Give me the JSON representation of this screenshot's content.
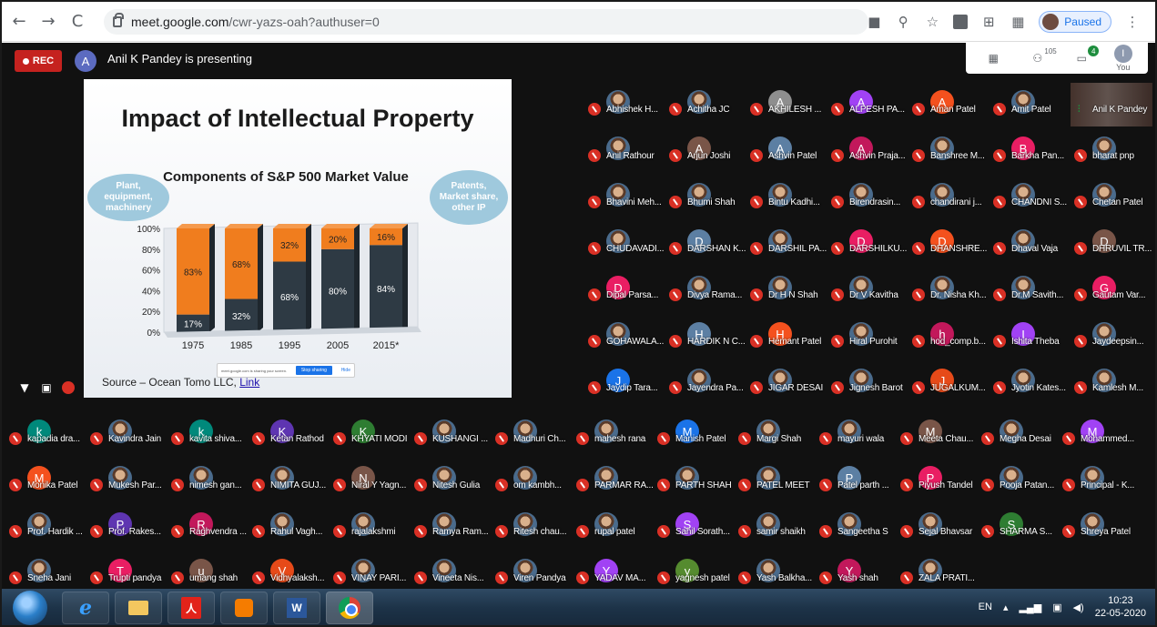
{
  "browser": {
    "back": "←",
    "forward": "→",
    "reload": "C",
    "url_host": "meet.google.com",
    "url_path": "/cwr-yazs-oah?authuser=0",
    "profile_status": "Paused"
  },
  "meet": {
    "rec_label": "REC",
    "presenter_initial": "A",
    "presenter_text": "Anil K Pandey is presenting",
    "people_count": "105",
    "chat_count": "4",
    "you_initial": "I",
    "you_label": "You"
  },
  "slide": {
    "title": "Impact of Intellectual Property",
    "chart_title": "Components of S&P 500 Market Value",
    "callout_left": "Plant, equipment, machinery",
    "callout_right": "Patents, Market share, other IP",
    "source": "Source – Ocean Tomo LLC,",
    "source_link": "Link",
    "share_text": "meet.google.com is sharing your screen.",
    "stop_sharing": "Stop sharing",
    "hide": "Hide"
  },
  "chart_data": {
    "type": "bar",
    "title": "Components of S&P 500 Market Value",
    "categories": [
      "1975",
      "1985",
      "1995",
      "2005",
      "2015*"
    ],
    "series": [
      {
        "values": [
          17,
          32,
          68,
          80,
          84
        ],
        "color": "#2e3a44"
      },
      {
        "values": [
          83,
          68,
          32,
          20,
          16
        ],
        "color": "#f07d1e"
      }
    ],
    "value_labels": {
      "bottom": [
        "17%",
        "32%",
        "68%",
        "80%",
        "84%"
      ],
      "top": [
        "83%",
        "68%",
        "32%",
        "20%",
        "16%"
      ]
    },
    "y_ticks": [
      "100%",
      "80%",
      "60%",
      "40%",
      "20%",
      "0%"
    ],
    "ylim": [
      0,
      100
    ]
  },
  "participants": [
    {
      "name": "Abhishek H...",
      "initial": "",
      "photo": true,
      "color": "#5f6368"
    },
    {
      "name": "Achitha JC",
      "initial": "",
      "photo": true,
      "color": "#5f6368"
    },
    {
      "name": "AKHILESH ...",
      "initial": "A",
      "photo": false,
      "color": "#8e8e8e"
    },
    {
      "name": "ALPESH PA...",
      "initial": "A",
      "photo": false,
      "color": "#a142f4"
    },
    {
      "name": "Aman Patel",
      "initial": "A",
      "photo": false,
      "color": "#f4511e"
    },
    {
      "name": "Amit Patel",
      "initial": "",
      "photo": true,
      "color": "#5f6368"
    },
    {
      "name": "Anil K Pandey",
      "initial": "",
      "photo": true,
      "color": "#5f6368",
      "speaking": true
    },
    {
      "name": "Anil Rathour",
      "initial": "",
      "photo": true,
      "color": "#5f6368"
    },
    {
      "name": "Arjun Joshi",
      "initial": "A",
      "photo": false,
      "color": "#795548"
    },
    {
      "name": "Ashvin Patel",
      "initial": "A",
      "photo": false,
      "color": "#5c7fa3"
    },
    {
      "name": "Ashvin Praja...",
      "initial": "A",
      "photo": false,
      "color": "#c2185b"
    },
    {
      "name": "Banshree M...",
      "initial": "",
      "photo": true,
      "color": "#5f6368"
    },
    {
      "name": "Barkha Pan...",
      "initial": "B",
      "photo": false,
      "color": "#e91e63"
    },
    {
      "name": "bharat pnp",
      "initial": "",
      "photo": true,
      "color": "#5f6368"
    },
    {
      "name": "Bhavini Meh...",
      "initial": "",
      "photo": true,
      "color": "#5f6368"
    },
    {
      "name": "Bhumi Shah",
      "initial": "",
      "photo": true,
      "color": "#5f6368"
    },
    {
      "name": "Bintu Kadhi...",
      "initial": "",
      "photo": true,
      "color": "#5f6368"
    },
    {
      "name": "Birendrasin...",
      "initial": "",
      "photo": true,
      "color": "#5f6368"
    },
    {
      "name": "chandirani j...",
      "initial": "",
      "photo": true,
      "color": "#5f6368"
    },
    {
      "name": "CHANDNI S...",
      "initial": "",
      "photo": true,
      "color": "#5f6368"
    },
    {
      "name": "Chetan Patel",
      "initial": "",
      "photo": true,
      "color": "#5f6368"
    },
    {
      "name": "CHUDAVADI...",
      "initial": "",
      "photo": true,
      "color": "#5f6368"
    },
    {
      "name": "DARSHAN K...",
      "initial": "D",
      "photo": false,
      "color": "#5c7fa3"
    },
    {
      "name": "DARSHIL PA...",
      "initial": "",
      "photo": true,
      "color": "#5f6368"
    },
    {
      "name": "DARSHILKU...",
      "initial": "D",
      "photo": false,
      "color": "#e91e63"
    },
    {
      "name": "DHANSHRE...",
      "initial": "D",
      "photo": false,
      "color": "#f4511e"
    },
    {
      "name": "Dhaval Vaja",
      "initial": "",
      "photo": true,
      "color": "#5f6368"
    },
    {
      "name": "DHRUVIL TR...",
      "initial": "D",
      "photo": false,
      "color": "#795548"
    },
    {
      "name": "Dipal Parsa...",
      "initial": "D",
      "photo": false,
      "color": "#e91e63"
    },
    {
      "name": "Divya Rama...",
      "initial": "",
      "photo": true,
      "color": "#5f6368"
    },
    {
      "name": "Dr H N Shah",
      "initial": "",
      "photo": true,
      "color": "#5f6368"
    },
    {
      "name": "Dr V Kavitha",
      "initial": "",
      "photo": true,
      "color": "#5f6368"
    },
    {
      "name": "Dr. Nisha Kh...",
      "initial": "",
      "photo": true,
      "color": "#5f6368"
    },
    {
      "name": "Dr.M Savith...",
      "initial": "",
      "photo": true,
      "color": "#5f6368"
    },
    {
      "name": "Gautam Var...",
      "initial": "G",
      "photo": false,
      "color": "#e91e63"
    },
    {
      "name": "GOHAWALA...",
      "initial": "",
      "photo": true,
      "color": "#5f6368"
    },
    {
      "name": "HARDIK N C...",
      "initial": "H",
      "photo": false,
      "color": "#5c7fa3"
    },
    {
      "name": "Hemant Patel",
      "initial": "H",
      "photo": false,
      "color": "#f4511e"
    },
    {
      "name": "Hiral Purohit",
      "initial": "",
      "photo": true,
      "color": "#5f6368"
    },
    {
      "name": "hod_comp.b...",
      "initial": "h",
      "photo": false,
      "color": "#c2185b"
    },
    {
      "name": "Ishita Theba",
      "initial": "I",
      "photo": false,
      "color": "#a142f4"
    },
    {
      "name": "Jaydeepsin...",
      "initial": "",
      "photo": true,
      "color": "#5f6368"
    },
    {
      "name": "Jaydip Tara...",
      "initial": "J",
      "photo": false,
      "color": "#1a73e8"
    },
    {
      "name": "Jayendra Pa...",
      "initial": "",
      "photo": true,
      "color": "#5f6368"
    },
    {
      "name": "JIGAR DESAI",
      "initial": "",
      "photo": true,
      "color": "#5f6368"
    },
    {
      "name": "Jignesh Barot",
      "initial": "",
      "photo": true,
      "color": "#5f6368"
    },
    {
      "name": "JUGALKUM...",
      "initial": "J",
      "photo": false,
      "color": "#e64a19"
    },
    {
      "name": "Jyotin Kates...",
      "initial": "",
      "photo": true,
      "color": "#5f6368"
    },
    {
      "name": "Kamlesh M...",
      "initial": "",
      "photo": true,
      "color": "#5f6368"
    },
    {
      "name": "kapadia dra...",
      "initial": "k",
      "photo": false,
      "color": "#00897b"
    },
    {
      "name": "Kavindra Jain",
      "initial": "",
      "photo": true,
      "color": "#5f6368"
    },
    {
      "name": "kavita shiva...",
      "initial": "k",
      "photo": false,
      "color": "#00897b"
    },
    {
      "name": "Ketan Rathod",
      "initial": "K",
      "photo": false,
      "color": "#5e35b1"
    },
    {
      "name": "KHYATI MODI",
      "initial": "K",
      "photo": false,
      "color": "#2e7d32"
    },
    {
      "name": "KUSHANGI ...",
      "initial": "",
      "photo": true,
      "color": "#5f6368"
    },
    {
      "name": "Madhuri Ch...",
      "initial": "",
      "photo": true,
      "color": "#5f6368"
    },
    {
      "name": "mahesh rana",
      "initial": "",
      "photo": true,
      "color": "#5f6368"
    },
    {
      "name": "Manish Patel",
      "initial": "M",
      "photo": false,
      "color": "#1a73e8"
    },
    {
      "name": "Margi Shah",
      "initial": "",
      "photo": true,
      "color": "#5f6368"
    },
    {
      "name": "mayuri wala",
      "initial": "",
      "photo": true,
      "color": "#5f6368"
    },
    {
      "name": "Meeta Chau...",
      "initial": "M",
      "photo": false,
      "color": "#795548"
    },
    {
      "name": "Megha Desai",
      "initial": "",
      "photo": true,
      "color": "#5f6368"
    },
    {
      "name": "Mohammed...",
      "initial": "M",
      "photo": false,
      "color": "#a142f4"
    },
    {
      "name": "Monika Patel",
      "initial": "M",
      "photo": false,
      "color": "#f4511e"
    },
    {
      "name": "Mukesh Par...",
      "initial": "",
      "photo": true,
      "color": "#5f6368"
    },
    {
      "name": "nimesh gan...",
      "initial": "",
      "photo": true,
      "color": "#5f6368"
    },
    {
      "name": "NIMITA GUJ...",
      "initial": "",
      "photo": true,
      "color": "#5f6368"
    },
    {
      "name": "Niral Y Yagn...",
      "initial": "N",
      "photo": false,
      "color": "#795548"
    },
    {
      "name": "Nitesh Gulia",
      "initial": "",
      "photo": true,
      "color": "#5f6368"
    },
    {
      "name": "om kambh...",
      "initial": "",
      "photo": true,
      "color": "#5f6368"
    },
    {
      "name": "PARMAR RA...",
      "initial": "",
      "photo": true,
      "color": "#5f6368"
    },
    {
      "name": "PARTH SHAH",
      "initial": "",
      "photo": true,
      "color": "#5f6368"
    },
    {
      "name": "PATEL MEET",
      "initial": "",
      "photo": true,
      "color": "#5f6368"
    },
    {
      "name": "Patel parth ...",
      "initial": "P",
      "photo": false,
      "color": "#5c7fa3"
    },
    {
      "name": "Piyush Tandel",
      "initial": "P",
      "photo": false,
      "color": "#e91e63"
    },
    {
      "name": "Pooja Patan...",
      "initial": "",
      "photo": true,
      "color": "#5f6368"
    },
    {
      "name": "Principal - K...",
      "initial": "",
      "photo": true,
      "color": "#5f6368"
    },
    {
      "name": "Prof. Hardik ...",
      "initial": "",
      "photo": true,
      "color": "#5f6368"
    },
    {
      "name": "Prof. Rakes...",
      "initial": "P",
      "photo": false,
      "color": "#5e35b1"
    },
    {
      "name": "Raghvendra ...",
      "initial": "R",
      "photo": false,
      "color": "#c2185b"
    },
    {
      "name": "Rahul Vagh...",
      "initial": "",
      "photo": true,
      "color": "#5f6368"
    },
    {
      "name": "rajalakshmi",
      "initial": "",
      "photo": true,
      "color": "#5f6368"
    },
    {
      "name": "Ramya Ram...",
      "initial": "",
      "photo": true,
      "color": "#5f6368"
    },
    {
      "name": "Ritesh chau...",
      "initial": "",
      "photo": true,
      "color": "#5f6368"
    },
    {
      "name": "rupal patel",
      "initial": "",
      "photo": true,
      "color": "#5f6368"
    },
    {
      "name": "Sahil Sorath...",
      "initial": "S",
      "photo": false,
      "color": "#a142f4"
    },
    {
      "name": "samir shaikh",
      "initial": "",
      "photo": true,
      "color": "#5f6368"
    },
    {
      "name": "Sangeetha S",
      "initial": "",
      "photo": true,
      "color": "#5f6368"
    },
    {
      "name": "Sejal Bhavsar",
      "initial": "",
      "photo": true,
      "color": "#5f6368"
    },
    {
      "name": "SHARMA S...",
      "initial": "S",
      "photo": false,
      "color": "#2e7d32"
    },
    {
      "name": "Shreya Patel",
      "initial": "",
      "photo": true,
      "color": "#5f6368"
    },
    {
      "name": "Sneha Jani",
      "initial": "",
      "photo": true,
      "color": "#5f6368"
    },
    {
      "name": "Trupti pandya",
      "initial": "T",
      "photo": false,
      "color": "#e91e63"
    },
    {
      "name": "umang shah",
      "initial": "u",
      "photo": false,
      "color": "#795548"
    },
    {
      "name": "Vidhyalaksh...",
      "initial": "V",
      "photo": false,
      "color": "#e64a19"
    },
    {
      "name": "VINAY PARI...",
      "initial": "",
      "photo": true,
      "color": "#5f6368"
    },
    {
      "name": "Vineeta Nis...",
      "initial": "",
      "photo": true,
      "color": "#5f6368"
    },
    {
      "name": "Viren Pandya",
      "initial": "",
      "photo": true,
      "color": "#5f6368"
    },
    {
      "name": "YADAV MA...",
      "initial": "Y",
      "photo": false,
      "color": "#a142f4"
    },
    {
      "name": "yagnesh patel",
      "initial": "y",
      "photo": false,
      "color": "#558b2f"
    },
    {
      "name": "Yash Balkha...",
      "initial": "",
      "photo": true,
      "color": "#5f6368"
    },
    {
      "name": "Yash shah",
      "initial": "Y",
      "photo": false,
      "color": "#c2185b"
    },
    {
      "name": "ZALA PRATI...",
      "initial": "",
      "photo": true,
      "color": "#5f6368"
    }
  ],
  "taskbar": {
    "lang": "EN",
    "time": "10:23",
    "date": "22-05-2020",
    "word_label": "W",
    "pdf_label": "人"
  }
}
